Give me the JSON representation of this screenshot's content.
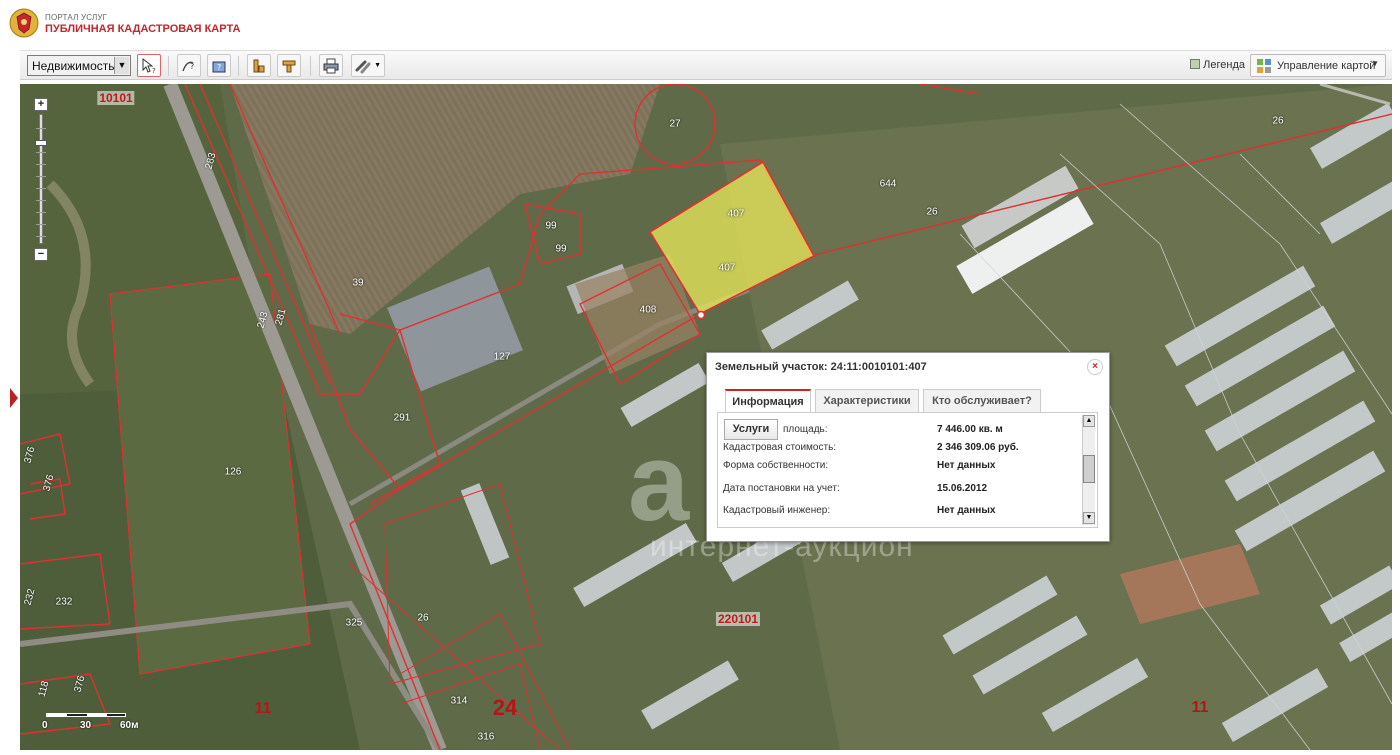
{
  "header": {
    "portal_subtitle": "ПОРТАЛ УСЛУГ",
    "portal_title": "ПУБЛИЧНАЯ КАДАСТРОВАЯ КАРТА"
  },
  "toolbar": {
    "layer_select_value": "Недвижимость",
    "legend_label": "Легенда",
    "map_control_label": "Управление картой"
  },
  "map": {
    "block_labels": [
      "10101",
      "220101"
    ],
    "big_labels": [
      "24",
      "11",
      "11"
    ],
    "plot_labels": [
      "27",
      "26",
      "26",
      "644",
      "407",
      "407",
      "99",
      "99",
      "39",
      "283",
      "281",
      "243",
      "408",
      "127",
      "291",
      "126",
      "325",
      "26",
      "314",
      "316",
      "232",
      "232",
      "376",
      "376",
      "118",
      "376"
    ],
    "scale": {
      "zero": "0",
      "mid": "30",
      "end": "60м"
    }
  },
  "popup": {
    "title": "Земельный участок: 24:11:0010101:407",
    "close_glyph": "×",
    "tabs": [
      "Информация",
      "Характеристики",
      "Кто обслуживает?"
    ],
    "services_button": "Услуги",
    "rows": [
      {
        "label": "площадь:",
        "value": "7 446.00 кв. м"
      },
      {
        "label": "Кадастровая стоимость:",
        "value": "2 346 309.06 руб."
      },
      {
        "label": "Формa собственности:",
        "value": "Нет данных"
      },
      {
        "label": "Дата постановки на учет:",
        "value": "15.06.2012"
      },
      {
        "label": "Кадастровый инженер:",
        "value": "Нет данных"
      }
    ]
  },
  "watermark": {
    "letter": "a",
    "text": "интернет-аукцион"
  },
  "colors": {
    "accent": "#c1272d",
    "selected_parcel": "#e6e65a",
    "parcel_border": "#e03030"
  }
}
